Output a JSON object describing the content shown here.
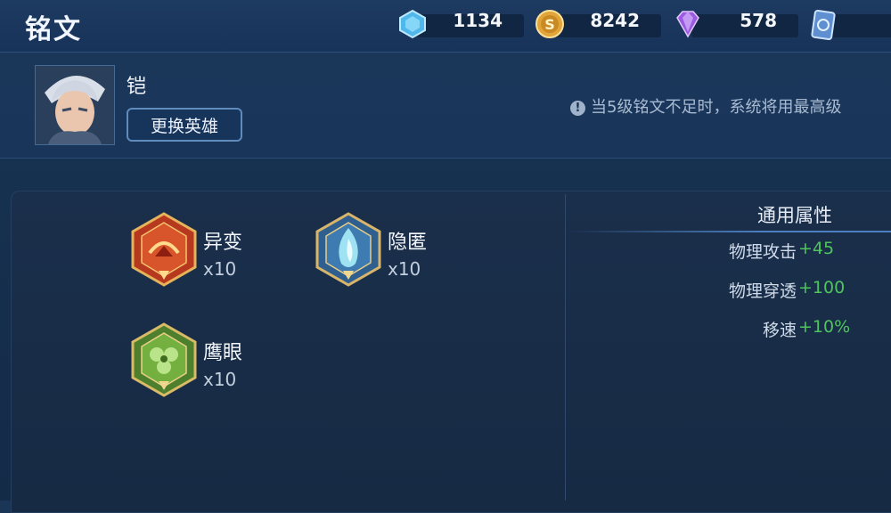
{
  "page_title": "铭文",
  "resources": [
    {
      "icon": "crystal-icon",
      "value": "1134"
    },
    {
      "icon": "gold-coin-icon",
      "value": "8242"
    },
    {
      "icon": "diamond-icon",
      "value": "578"
    },
    {
      "icon": "card-icon",
      "value": ""
    }
  ],
  "hero": {
    "name": "铠",
    "change_button": "更换英雄"
  },
  "notice": "当5级铭文不足时，系统将用最高级",
  "inscriptions": [
    {
      "name": "异变",
      "count": "x10",
      "icon": "red-inscription-icon"
    },
    {
      "name": "隐匿",
      "count": "x10",
      "icon": "blue-inscription-icon"
    },
    {
      "name": "鹰眼",
      "count": "x10",
      "icon": "green-inscription-icon"
    }
  ],
  "attributes": {
    "title": "通用属性",
    "rows": [
      {
        "label": "物理攻击",
        "value": "+45"
      },
      {
        "label": "物理穿透",
        "value": "+100"
      },
      {
        "label": "移速",
        "value": "+10%"
      }
    ]
  },
  "colors": {
    "accent_green": "#4fc45e",
    "background": "#16304f"
  }
}
